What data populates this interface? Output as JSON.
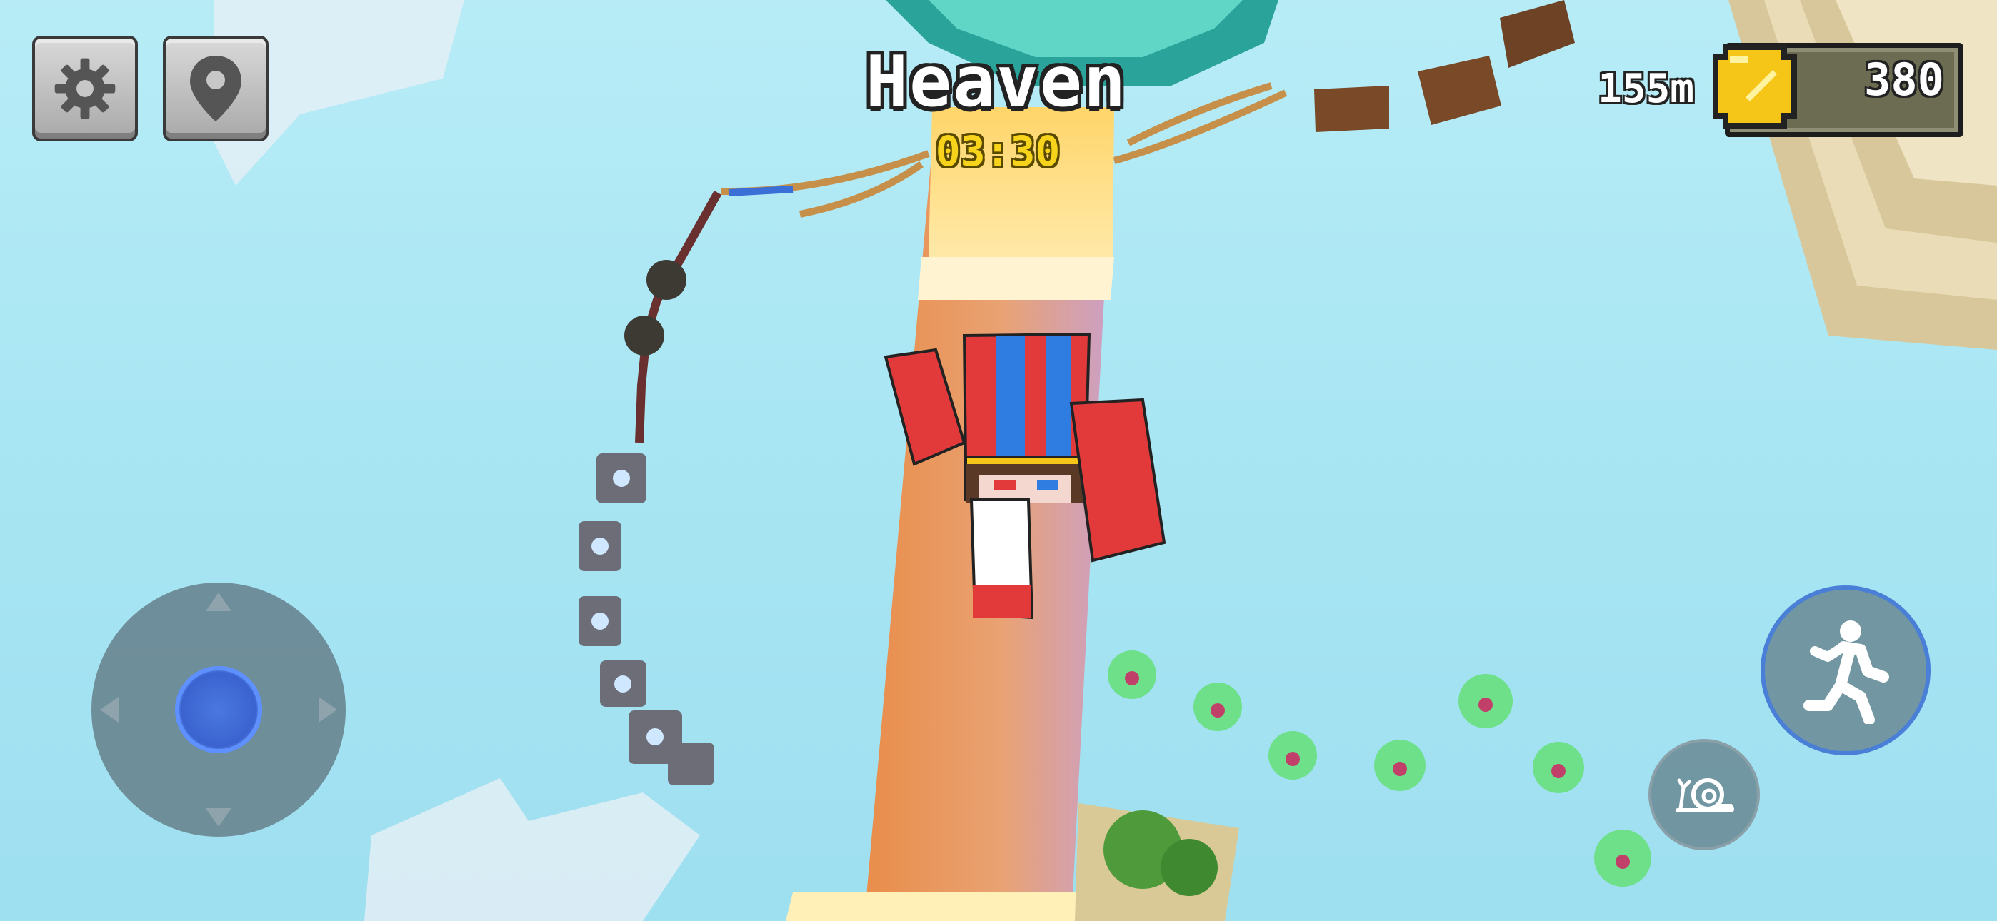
{
  "hud": {
    "level_title": "Heaven",
    "timer": "03:30",
    "height_readout": "155m",
    "coins": "380"
  },
  "buttons": {
    "settings_icon": "gear-icon",
    "map_icon": "map-pin-icon",
    "run_icon": "running-figure-icon",
    "slow_icon": "snail-icon"
  },
  "colors": {
    "sky": "#a9e6f3",
    "title_text": "#ffffff",
    "timer_text": "#f7d31b",
    "coin_gold": "#f5c518",
    "joystick_knob": "#3b63cf",
    "run_ring": "#4a7fd8"
  }
}
